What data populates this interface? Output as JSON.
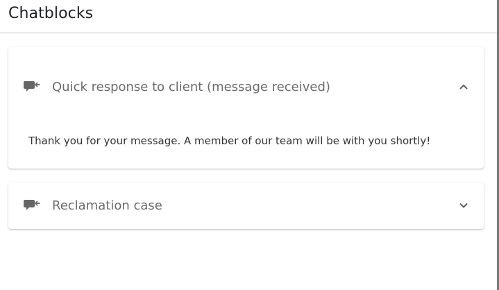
{
  "header": {
    "title": "Chatblocks"
  },
  "chatblocks": [
    {
      "title": "Quick response to client (message received)",
      "expanded": true,
      "body": "Thank you for your message. A member of our team will be with you shortly!",
      "icon": "chat-reply-icon",
      "chevron": "chevron-up-icon"
    },
    {
      "title": "Reclamation case",
      "expanded": false,
      "icon": "chat-reply-icon",
      "chevron": "chevron-down-icon"
    }
  ],
  "colors": {
    "title_text": "#202124",
    "label_text": "#6b6b6b",
    "body_text": "#333333",
    "icon": "#666666"
  }
}
